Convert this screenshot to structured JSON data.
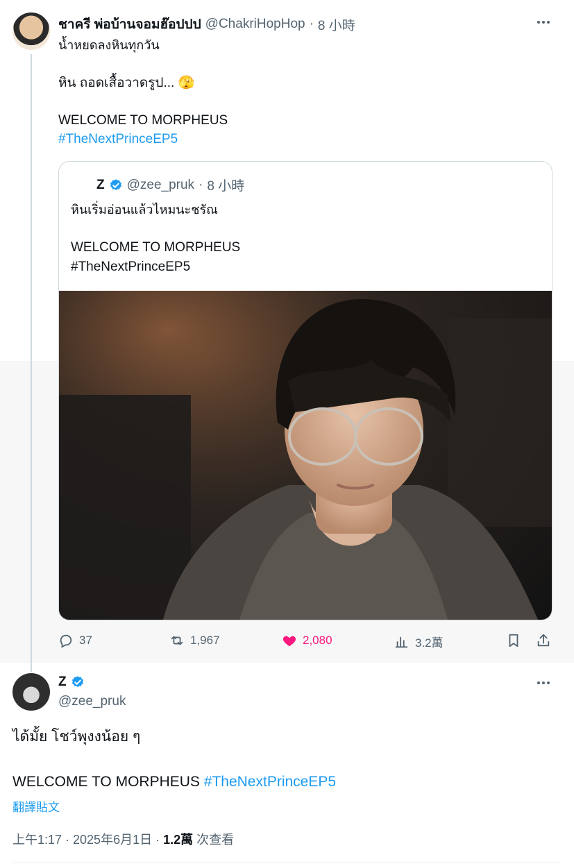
{
  "tweet1": {
    "name": "ชาครี พ่อบ้านจอมฮ๊อปปป",
    "handle": "@ChakriHopHop",
    "dot": "·",
    "time": "8 小時",
    "line1": "น้ำหยดลงหินทุกวัน",
    "line2": "หิน ถอดเสื้อวาดรูป... 🫣",
    "line3": "WELCOME TO MORPHEUS",
    "hashtag": "#TheNextPrinceEP5"
  },
  "quote": {
    "name": "Z",
    "handle": "@zee_pruk",
    "dot": "·",
    "time": "8 小時",
    "line1": "หินเริ่มอ่อนแล้วไหมนะชรัณ",
    "line2": "WELCOME TO MORPHEUS",
    "line3": "#TheNextPrinceEP5"
  },
  "actions": {
    "replies": "37",
    "retweets": "1,967",
    "likes": "2,080",
    "views": "3.2萬"
  },
  "main": {
    "name": "Z",
    "handle": "@zee_pruk",
    "line1": "ได้มั้ย โชว์พุงงน้อย ๆ",
    "line2": "WELCOME TO MORPHEUS",
    "hashtag": "#TheNextPrinceEP5",
    "translate": "翻譯貼文",
    "timestamp": "上午1:17 · 2025年6月1日 · ",
    "views_count": "1.2萬",
    "views_label": " 次查看"
  },
  "colors": {
    "link": "#1d9bf0",
    "like": "#f91880",
    "secondary": "#536471"
  }
}
